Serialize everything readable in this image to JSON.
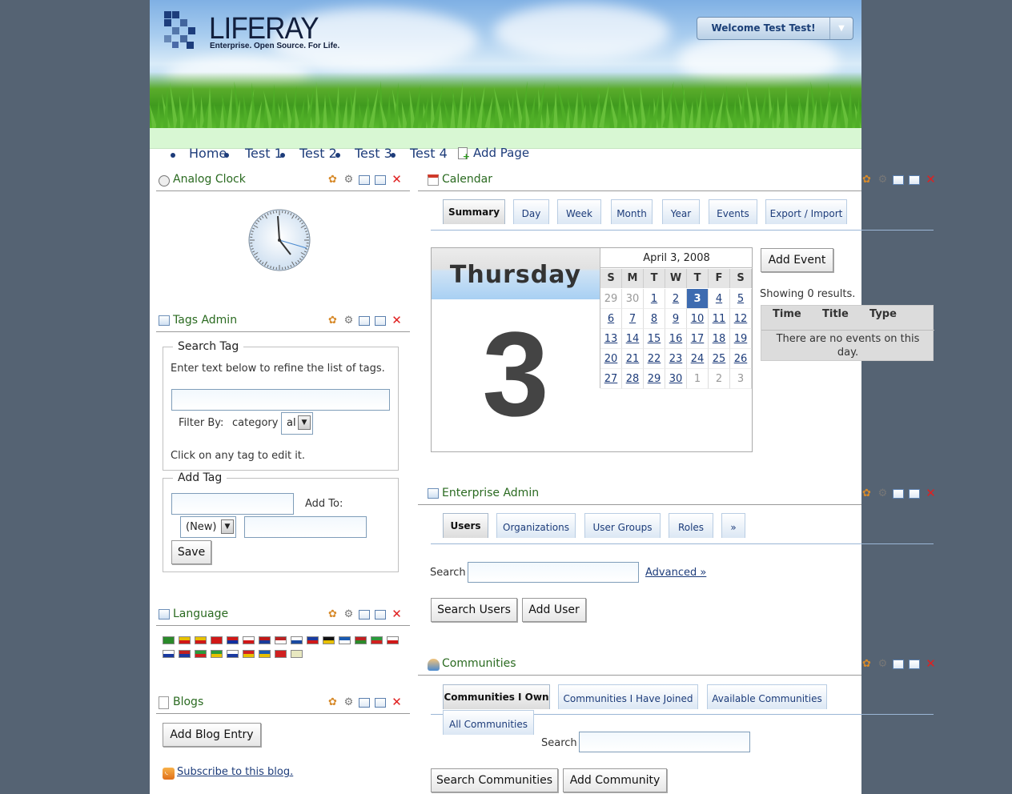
{
  "header": {
    "logo_text": "LIFERAY",
    "logo_tagline": "Enterprise. Open Source. For Life.",
    "welcome": "Welcome Test Test!"
  },
  "nav": {
    "items": [
      "Home",
      "Test 1",
      "Test 2",
      "Test 3",
      "Test 4"
    ],
    "add_page": "Add Page"
  },
  "analog_clock": {
    "title": "Analog Clock"
  },
  "tags_admin": {
    "title": "Tags Admin",
    "search_legend": "Search Tag",
    "search_hint": "Enter text below to refine the list of tags.",
    "filter_label": "Filter By:",
    "category_label": "category",
    "category_value": "al",
    "edit_hint": "Click on any tag to edit it.",
    "add_legend": "Add Tag",
    "add_to_label": "Add To:",
    "new_value": "(New)",
    "save": "Save"
  },
  "language": {
    "title": "Language",
    "flags": [
      "ar",
      "ca",
      "ca",
      "zh_CN",
      "zh_TW",
      "cs",
      "nl",
      "en",
      "fi",
      "fr",
      "de",
      "el",
      "hu",
      "it",
      "ja",
      "ko",
      "nb",
      "fa",
      "pt",
      "ru",
      "es",
      "sv",
      "tr",
      "vi"
    ]
  },
  "blogs": {
    "title": "Blogs",
    "add_entry": "Add Blog Entry",
    "subscribe": "Subscribe to this blog."
  },
  "calendar": {
    "title": "Calendar",
    "tabs": [
      "Summary",
      "Day",
      "Week",
      "Month",
      "Year",
      "Events",
      "Export / Import"
    ],
    "day_name": "Thursday",
    "day_number": "3",
    "month_title": "April 3, 2008",
    "weekdays": [
      "S",
      "M",
      "T",
      "W",
      "T",
      "F",
      "S"
    ],
    "weeks": [
      [
        "29",
        "30",
        "1",
        "2",
        "3",
        "4",
        "5"
      ],
      [
        "6",
        "7",
        "8",
        "9",
        "10",
        "11",
        "12"
      ],
      [
        "13",
        "14",
        "15",
        "16",
        "17",
        "18",
        "19"
      ],
      [
        "20",
        "21",
        "22",
        "23",
        "24",
        "25",
        "26"
      ],
      [
        "27",
        "28",
        "29",
        "30",
        "1",
        "2",
        "3"
      ]
    ],
    "add_event": "Add Event",
    "results": "Showing 0 results.",
    "columns": [
      "Time",
      "Title",
      "Type"
    ],
    "empty": "There are no events on this day."
  },
  "enterprise_admin": {
    "title": "Enterprise Admin",
    "tabs": [
      "Users",
      "Organizations",
      "User Groups",
      "Roles",
      "»"
    ],
    "search_label": "Search",
    "advanced": "Advanced »",
    "search_users": "Search Users",
    "add_user": "Add User"
  },
  "communities": {
    "title": "Communities",
    "tabs": [
      "Communities I Own",
      "Communities I Have Joined",
      "Available Communities",
      "All Communities"
    ],
    "search_label": "Search",
    "search_communities": "Search Communities",
    "add_community": "Add Community"
  },
  "colors": {
    "background": "#556373",
    "portlet_title": "#2a6a20",
    "link": "#1d3c7a",
    "today": "#3d6bb0"
  }
}
